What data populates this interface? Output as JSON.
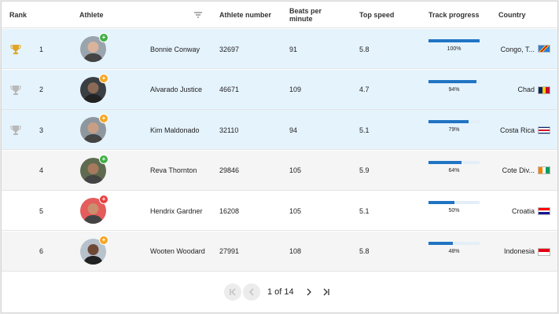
{
  "columns": {
    "rank": "Rank",
    "athlete": "Athlete",
    "athlete_number": "Athlete number",
    "bpm": "Beats per minute",
    "top_speed": "Top speed",
    "track_progress": "Track progress",
    "country": "Country"
  },
  "rows": [
    {
      "trophy": "gold",
      "rank": "1",
      "name": "Bonnie Conway",
      "number": "32697",
      "bpm": "91",
      "speed": "5.8",
      "progress": 100,
      "progress_label": "100%",
      "country": "Congo, T...",
      "badge": "+",
      "badge_color": "#43b047",
      "highlight": true
    },
    {
      "trophy": "silver",
      "rank": "2",
      "name": "Alvarado Justice",
      "number": "46671",
      "bpm": "109",
      "speed": "4.7",
      "progress": 94,
      "progress_label": "94%",
      "country": "Chad",
      "badge": "+",
      "badge_color": "#f5a623",
      "highlight": true
    },
    {
      "trophy": "silver",
      "rank": "3",
      "name": "Kim Maldonado",
      "number": "32110",
      "bpm": "94",
      "speed": "5.1",
      "progress": 79,
      "progress_label": "79%",
      "country": "Costa Rica",
      "badge": "+",
      "badge_color": "#f5a623",
      "highlight": true
    },
    {
      "trophy": "",
      "rank": "4",
      "name": "Reva Thornton",
      "number": "29846",
      "bpm": "105",
      "speed": "5.9",
      "progress": 64,
      "progress_label": "64%",
      "country": "Cote Div...",
      "badge": "+",
      "badge_color": "#43b047",
      "highlight": false
    },
    {
      "trophy": "",
      "rank": "5",
      "name": "Hendrix Gardner",
      "number": "16208",
      "bpm": "105",
      "speed": "5.1",
      "progress": 50,
      "progress_label": "50%",
      "country": "Croatia",
      "badge": "+",
      "badge_color": "#e84343",
      "highlight": false
    },
    {
      "trophy": "",
      "rank": "6",
      "name": "Wooten Woodard",
      "number": "27991",
      "bpm": "108",
      "speed": "5.8",
      "progress": 48,
      "progress_label": "48%",
      "country": "Indonesia",
      "badge": "+",
      "badge_color": "#f5a623",
      "highlight": false
    }
  ],
  "pager": {
    "label": "1 of 14"
  }
}
